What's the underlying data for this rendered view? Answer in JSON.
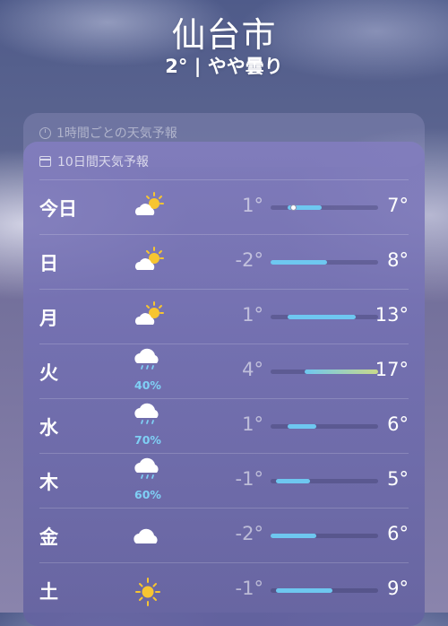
{
  "header": {
    "city": "仙台市",
    "condition": "2° | やや曇り"
  },
  "hourly": {
    "label": "1時間ごとの天気予報"
  },
  "daily": {
    "label": "10日間天気予報",
    "days": [
      {
        "day": "今日",
        "icon": "partly-sunny-icon",
        "pop": "",
        "low": "1°",
        "high": "7°",
        "low_value": 1,
        "high_value": 7,
        "current_value": 2
      },
      {
        "day": "日",
        "icon": "partly-sunny-icon",
        "pop": "",
        "low": "-2°",
        "high": "8°",
        "low_value": -2,
        "high_value": 8
      },
      {
        "day": "月",
        "icon": "partly-sunny-icon",
        "pop": "",
        "low": "1°",
        "high": "13°",
        "low_value": 1,
        "high_value": 13
      },
      {
        "day": "火",
        "icon": "rain-cloud-icon",
        "pop": "40%",
        "low": "4°",
        "high": "17°",
        "low_value": 4,
        "high_value": 17
      },
      {
        "day": "水",
        "icon": "rain-cloud-icon",
        "pop": "70%",
        "low": "1°",
        "high": "6°",
        "low_value": 1,
        "high_value": 6
      },
      {
        "day": "木",
        "icon": "rain-cloud-icon",
        "pop": "60%",
        "low": "-1°",
        "high": "5°",
        "low_value": -1,
        "high_value": 5
      },
      {
        "day": "金",
        "icon": "cloud-icon",
        "pop": "",
        "low": "-2°",
        "high": "6°",
        "low_value": -2,
        "high_value": 6
      },
      {
        "day": "土",
        "icon": "sun-icon",
        "pop": "",
        "low": "-1°",
        "high": "9°",
        "low_value": -1,
        "high_value": 9
      }
    ]
  },
  "colors": {
    "cool": "#6ec7f0",
    "warm": "#c9d98a"
  }
}
